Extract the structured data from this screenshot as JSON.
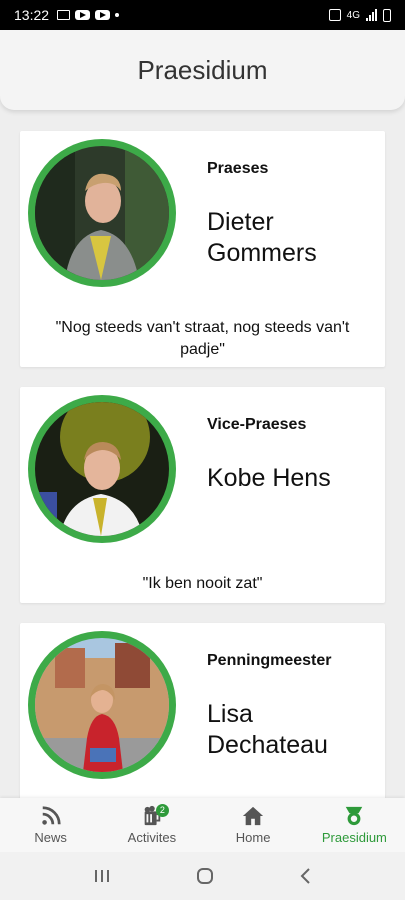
{
  "status_bar": {
    "time": "13:22",
    "network": "4G"
  },
  "app_bar": {
    "title": "Praesidium"
  },
  "members": [
    {
      "role": "Praeses",
      "name": "Dieter Gommers",
      "quote": "\"Nog steeds van't straat, nog steeds van't padje\""
    },
    {
      "role": "Vice-Praeses",
      "name": "Kobe Hens",
      "quote": "\"Ik ben nooit zat\""
    },
    {
      "role": "Penningmeester",
      "name": "Lisa Dechateau",
      "quote": ""
    }
  ],
  "bottom_nav": {
    "items": [
      {
        "label": "News",
        "icon": "rss-icon"
      },
      {
        "label": "Activites",
        "icon": "beer-icon",
        "badge": "2"
      },
      {
        "label": "Home",
        "icon": "home-icon"
      },
      {
        "label": "Praesidium",
        "icon": "medal-icon",
        "active": true
      }
    ]
  },
  "colors": {
    "accent": "#3daa48",
    "active_nav": "#2e9a3a"
  }
}
